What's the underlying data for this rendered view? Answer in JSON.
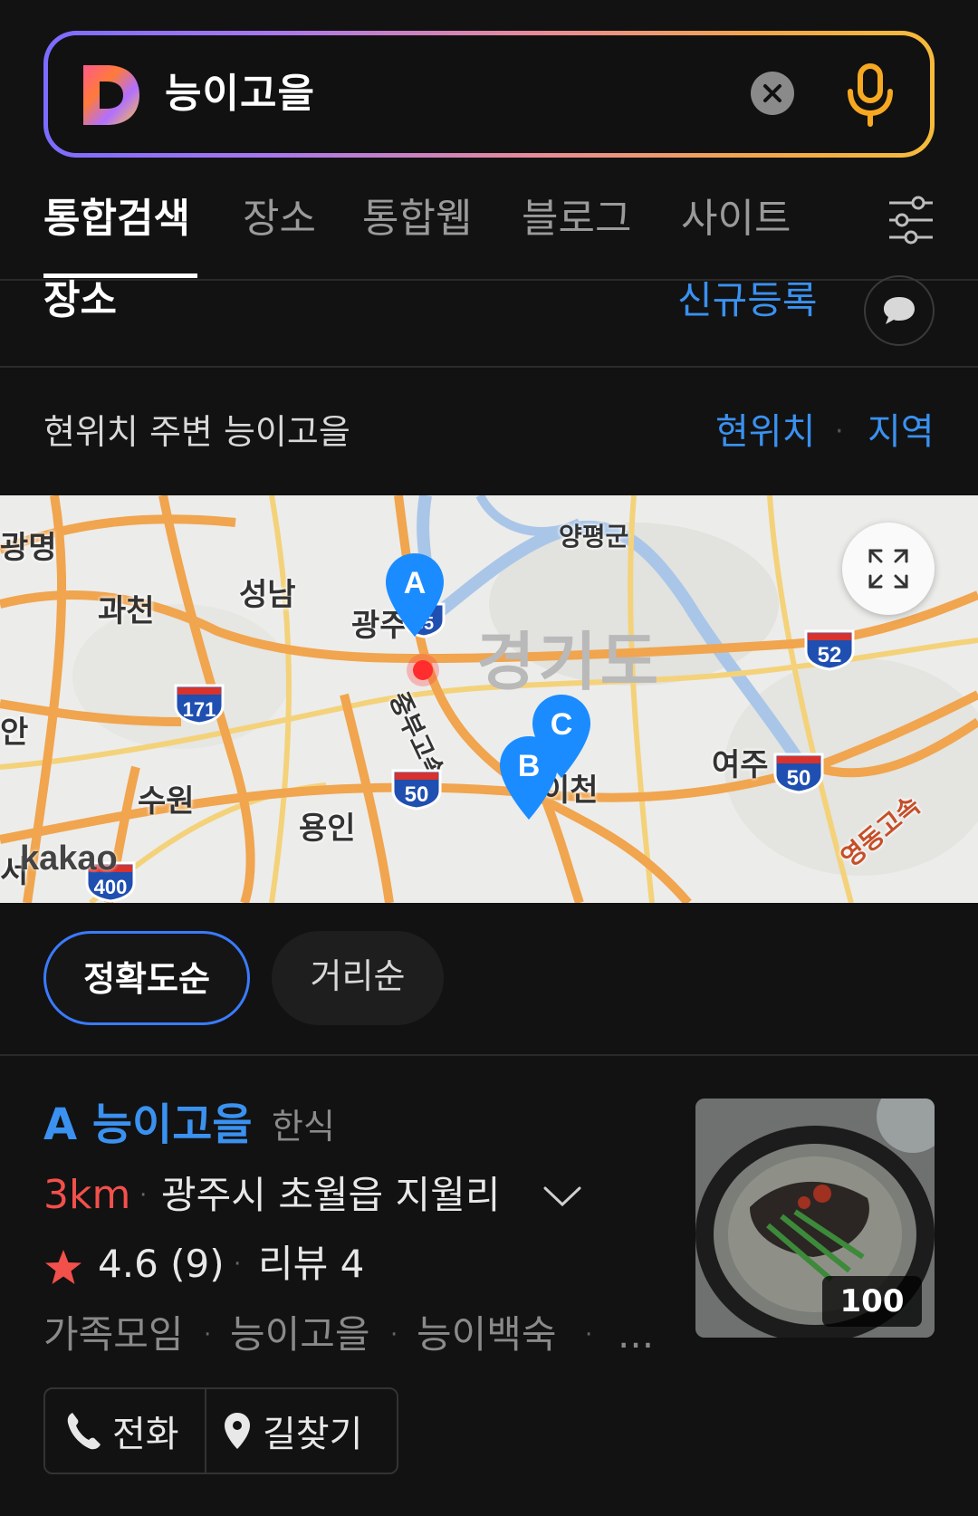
{
  "search": {
    "query": "능이고을",
    "icons": {
      "logo": "daum-d-logo",
      "clear": "clear-icon",
      "mic": "mic-icon"
    },
    "colors": {
      "border_start": "#7b6cff",
      "border_end": "#f6bb3a",
      "mic": "#f6a821"
    }
  },
  "tabs": [
    {
      "label": "통합검색",
      "active": true
    },
    {
      "label": "장소",
      "active": false
    },
    {
      "label": "통합웹",
      "active": false
    },
    {
      "label": "블로그",
      "active": false
    },
    {
      "label": "사이트",
      "active": false
    }
  ],
  "filter_icon": "filter-sliders-icon",
  "place_section": {
    "title": "장소",
    "new_register": "신규등록",
    "chat_icon": "chat-bubble-icon"
  },
  "nearby": {
    "text": "현위치 주변 능이고을",
    "current_location": "현위치",
    "separator": "·",
    "region": "지역"
  },
  "map": {
    "labels": {
      "yangpyeong": "양평군",
      "gwangmyeong": "광명",
      "seongnam": "성남",
      "gwacheon": "과천",
      "gwangju": "광주",
      "gyeonggi": "경기도",
      "yeoju": "여주",
      "suwon": "수원",
      "yongin": "용인",
      "icheon": "이천",
      "jungbu_expwy": "중부고속",
      "yeongdong_expwy": "영동고속",
      "an": "안",
      "seo": "서"
    },
    "route_shields": [
      "52",
      "171",
      "50",
      "50",
      "400",
      "35"
    ],
    "pins": [
      {
        "letter": "A",
        "color": "#1a8cff"
      },
      {
        "letter": "B",
        "color": "#1a8cff"
      },
      {
        "letter": "C",
        "color": "#1a8cff"
      }
    ],
    "watermark": "kakao",
    "expand_icon": "expand-icon"
  },
  "sort": {
    "accuracy": "정확도순",
    "distance": "거리순",
    "active": "정확도순"
  },
  "result": {
    "letter": "A",
    "name": "능이고을",
    "category": "한식",
    "distance": "3km",
    "address": "광주시 초월읍 지월리",
    "rating": "4.6 (9)",
    "review": "리뷰 4",
    "tags": [
      "가족모임",
      "능이고을",
      "능이백숙"
    ],
    "more": "...",
    "photo_count": "100",
    "actions": {
      "call": "전화",
      "directions": "길찾기"
    },
    "colors": {
      "title": "#3a91f0",
      "distance": "#f2504b",
      "star": "#f2504b"
    }
  }
}
